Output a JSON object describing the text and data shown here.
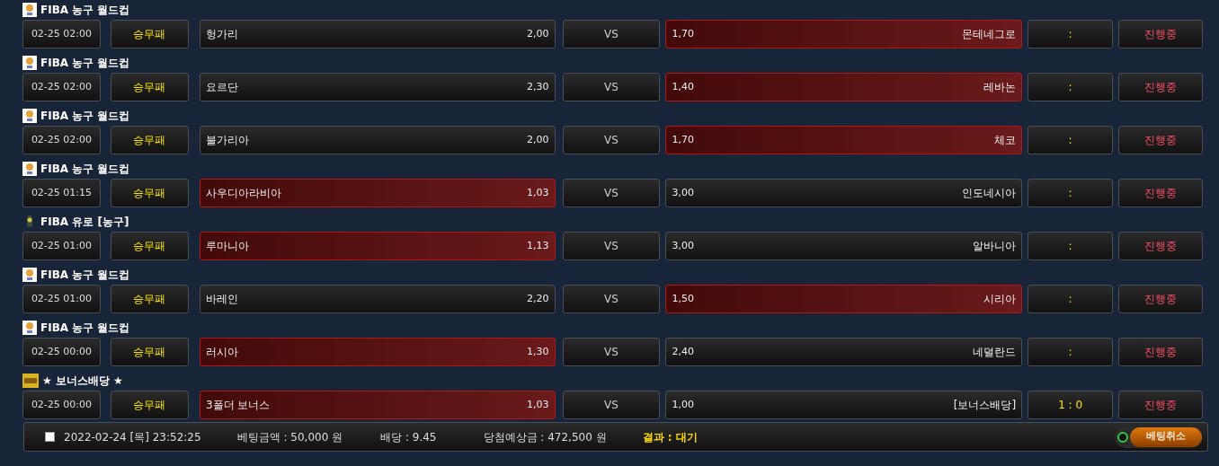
{
  "games": [
    {
      "league": "FIBA 농구 월드컵",
      "kind": "fiba",
      "time": "02-25 02:00",
      "type": "승무패",
      "home": {
        "name": "헝가리",
        "odds": "2,00",
        "selected": false
      },
      "vs": "VS",
      "away": {
        "name": "몬테네그로",
        "odds": "1,70",
        "selected": true
      },
      "score": ":",
      "status": "진행중"
    },
    {
      "league": "FIBA 농구 월드컵",
      "kind": "fiba",
      "time": "02-25 02:00",
      "type": "승무패",
      "home": {
        "name": "요르단",
        "odds": "2,30",
        "selected": false
      },
      "vs": "VS",
      "away": {
        "name": "레바논",
        "odds": "1,40",
        "selected": true
      },
      "score": ":",
      "status": "진행중"
    },
    {
      "league": "FIBA 농구 월드컵",
      "kind": "fiba",
      "time": "02-25 02:00",
      "type": "승무패",
      "home": {
        "name": "불가리아",
        "odds": "2,00",
        "selected": false
      },
      "vs": "VS",
      "away": {
        "name": "체코",
        "odds": "1,70",
        "selected": true
      },
      "score": ":",
      "status": "진행중"
    },
    {
      "league": "FIBA 농구 월드컵",
      "kind": "fiba",
      "time": "02-25 01:15",
      "type": "승무패",
      "home": {
        "name": "사우디아라비아",
        "odds": "1,03",
        "selected": true
      },
      "vs": "VS",
      "away": {
        "name": "인도네시아",
        "odds": "3,00",
        "selected": false
      },
      "score": ":",
      "status": "진행중"
    },
    {
      "league": "FIBA 유로 [농구]",
      "kind": "euro",
      "time": "02-25 01:00",
      "type": "승무패",
      "home": {
        "name": "루마니아",
        "odds": "1,13",
        "selected": true
      },
      "vs": "VS",
      "away": {
        "name": "알바니아",
        "odds": "3,00",
        "selected": false
      },
      "score": ":",
      "status": "진행중"
    },
    {
      "league": "FIBA 농구 월드컵",
      "kind": "fiba",
      "time": "02-25 01:00",
      "type": "승무패",
      "home": {
        "name": "바레인",
        "odds": "2,20",
        "selected": false
      },
      "vs": "VS",
      "away": {
        "name": "시리아",
        "odds": "1,50",
        "selected": true
      },
      "score": ":",
      "status": "진행중"
    },
    {
      "league": "FIBA 농구 월드컵",
      "kind": "fiba",
      "time": "02-25 00:00",
      "type": "승무패",
      "home": {
        "name": "러시아",
        "odds": "1,30",
        "selected": true
      },
      "vs": "VS",
      "away": {
        "name": "네덜란드",
        "odds": "2,40",
        "selected": false
      },
      "score": ":",
      "status": "진행중"
    },
    {
      "league": "★ 보너스배당 ★",
      "kind": "bonus",
      "time": "02-25 00:00",
      "type": "승무패",
      "home": {
        "name": "3폴더 보너스",
        "odds": "1,03",
        "selected": true
      },
      "vs": "VS",
      "away": {
        "name": "[보너스배당]",
        "odds": "1,00",
        "selected": false
      },
      "score": "1 : 0",
      "status": "진행중"
    }
  ],
  "footer": {
    "checked": false,
    "datetime": "2022-02-24 [목] 23:52:25",
    "amount": "베팅금액 : 50,000 원",
    "odds": "배당 : 9.45",
    "expected": "당첨예상금 : 472,500 원",
    "result": "결과 : 대기",
    "cancel": "베팅취소"
  }
}
